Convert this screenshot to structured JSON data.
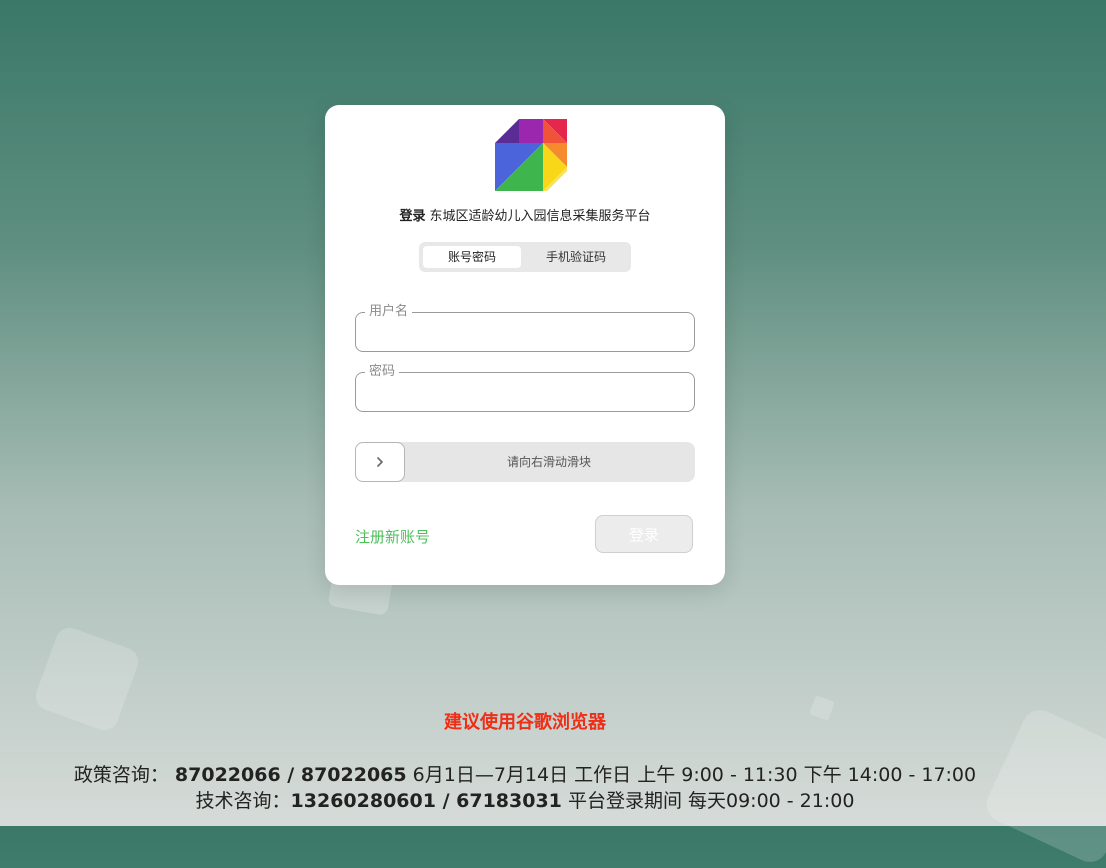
{
  "login": {
    "heading_bold": "登录",
    "heading_title": "东城区适龄幼儿入园信息采集服务平台",
    "tabs": [
      {
        "label": "账号密码",
        "active": true
      },
      {
        "label": "手机验证码",
        "active": false
      }
    ],
    "username": {
      "label": "用户名",
      "value": ""
    },
    "password": {
      "label": "密码",
      "value": ""
    },
    "slider": {
      "text": "请向右滑动滑块",
      "icon": "chevron-right-icon"
    },
    "register_link": "注册新账号",
    "login_button": "登录"
  },
  "footer": {
    "browser_tip": "建议使用谷歌浏览器",
    "policy": {
      "label": "政策咨询：",
      "phones": "87022066 / 87022065",
      "hours": "6月1日—7月14日 工作日 上午 9:00 - 11:30 下午 14:00 - 17:00"
    },
    "tech": {
      "label": "技术咨询：",
      "phones": "13260280601 / 67183031",
      "hours": "平台登录期间 每天09:00 - 21:00"
    }
  },
  "colors": {
    "accent_green": "#4fbf5c",
    "tip_red": "#ee2e17",
    "bg_top": "#3a7867",
    "bg_bottom": "#d6dbd8"
  }
}
